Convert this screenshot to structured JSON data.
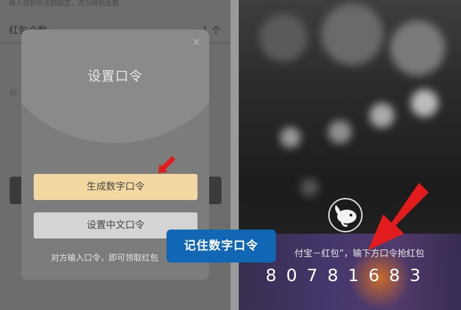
{
  "left_screen": {
    "background": {
      "hint_text": "每人领到的金额固定，改为随机金额",
      "row_label": "红包个数",
      "row_value": "1 个",
      "faint_text": "拆"
    },
    "dialog": {
      "close_icon": "×",
      "title": "设置口令",
      "generate_number_button": "生成数字口令",
      "set_chinese_button": "设置中文口令",
      "hint": "对方输入口令，即可领取红包"
    }
  },
  "right_screen": {
    "instruction_text": "付宝－红包”，输下方口令抢红包",
    "code": "80781683"
  },
  "overlay_label": "记住数字口令",
  "colors": {
    "accent_blue": "#1167b4",
    "button_gold": "#f3d8a2",
    "arrow_red": "#e21c1c"
  },
  "icons": [
    "close-icon",
    "red-arrow-icon",
    "logo-icon"
  ]
}
